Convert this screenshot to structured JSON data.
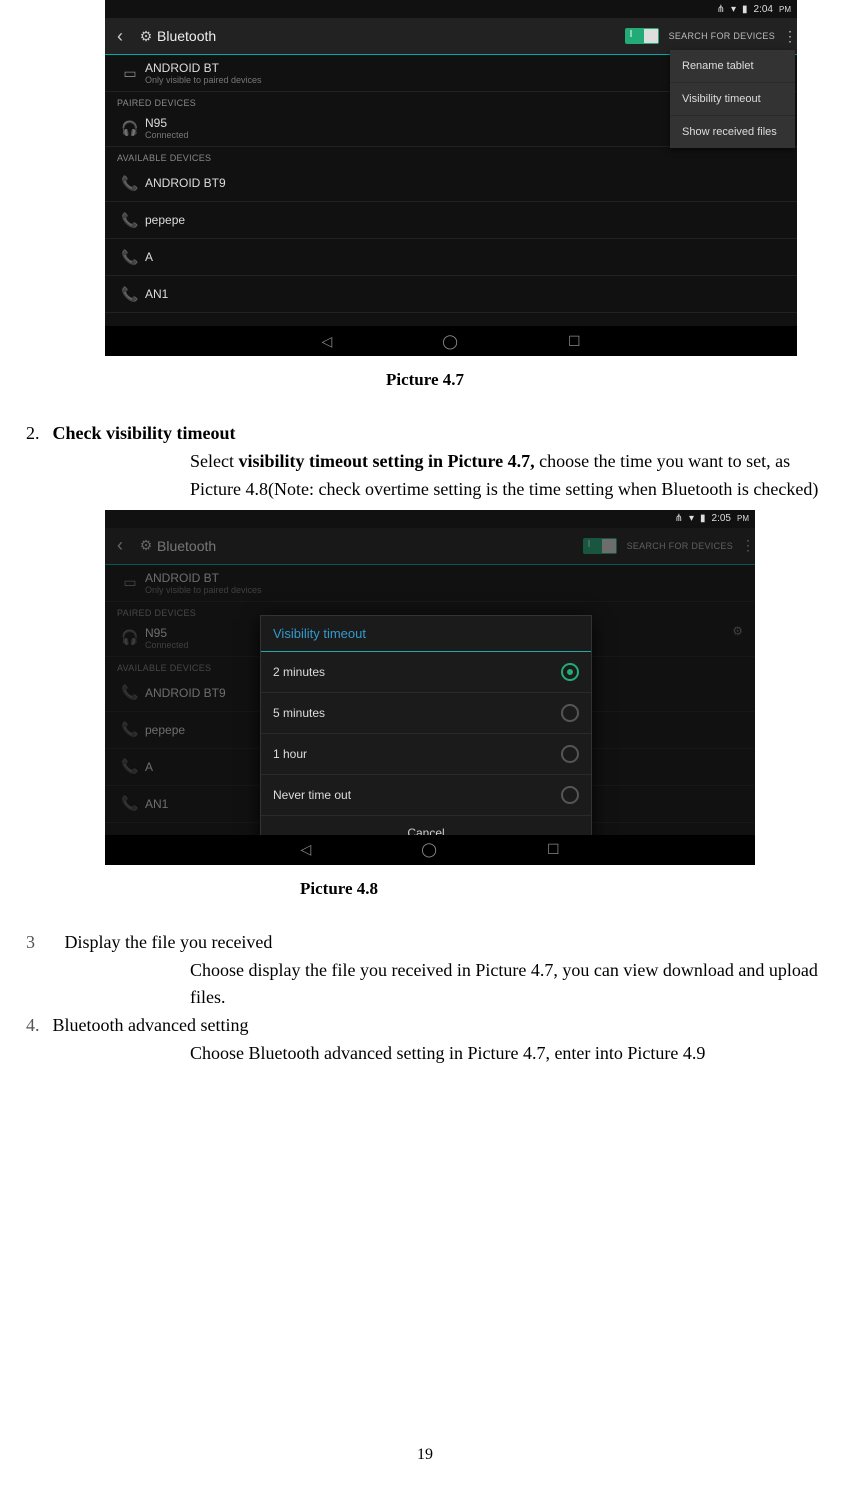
{
  "shot1": {
    "status": {
      "time": "2:04",
      "ampm": "PM"
    },
    "header": {
      "title": "Bluetooth",
      "toggle_label": "I",
      "search": "SEARCH FOR DEVICES"
    },
    "self": {
      "name": "ANDROID BT",
      "sub": "Only visible to paired devices"
    },
    "sec_paired": "PAIRED DEVICES",
    "paired": {
      "name": "N95",
      "sub": "Connected"
    },
    "sec_avail": "AVAILABLE DEVICES",
    "avail": [
      "ANDROID BT9",
      "pepepe",
      "A",
      "AN1"
    ],
    "menu": [
      "Rename tablet",
      "Visibility timeout",
      "Show received files"
    ]
  },
  "caption1": "Picture 4.7",
  "item2": {
    "num": "2.",
    "title": "Check visibility timeout",
    "body_pre": "Select ",
    "body_bold": "visibility timeout setting in Picture 4.7,",
    "body_post": " choose the time you want to set, as Picture 4.8(Note: check overtime setting is the time setting when Bluetooth is checked)"
  },
  "shot2": {
    "status": {
      "time": "2:05",
      "ampm": "PM"
    },
    "header": {
      "title": "Bluetooth",
      "toggle_label": "I",
      "search": "SEARCH FOR DEVICES"
    },
    "self": {
      "name": "ANDROID BT",
      "sub": "Only visible to paired devices"
    },
    "sec_paired": "PAIRED DEVICES",
    "paired": {
      "name": "N95",
      "sub": "Connected"
    },
    "sec_avail": "AVAILABLE DEVICES",
    "avail": [
      "ANDROID BT9",
      "pepepe",
      "A",
      "AN1"
    ],
    "dialog": {
      "title": "Visibility timeout",
      "options": [
        "2 minutes",
        "5 minutes",
        "1 hour",
        "Never time out"
      ],
      "selected": 0,
      "cancel": "Cancel"
    }
  },
  "caption2": "Picture 4.8",
  "item3": {
    "num": "3",
    "title": "Display the file you received",
    "body": "Choose display the file you received in Picture 4.7, you can view download and upload files."
  },
  "item4": {
    "num": "4.",
    "title": "Bluetooth advanced setting",
    "body": "Choose Bluetooth advanced setting in Picture 4.7, enter into Picture 4.9"
  },
  "page_number": "19"
}
